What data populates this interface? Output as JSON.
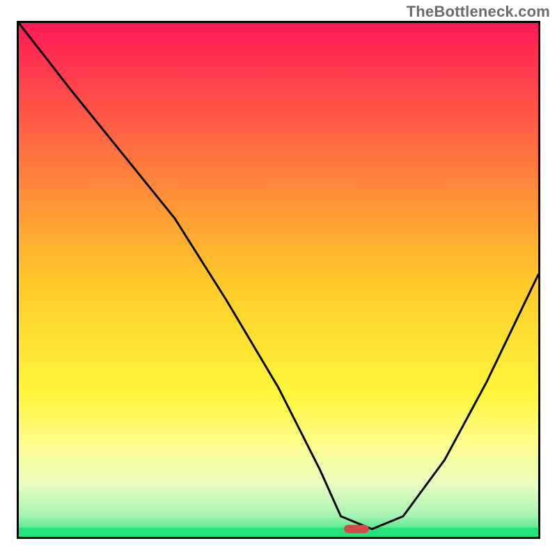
{
  "watermark": "TheBottleneck.com",
  "chart_data": {
    "type": "line",
    "title": "",
    "xlabel": "",
    "ylabel": "",
    "xlim": [
      0,
      100
    ],
    "ylim": [
      0,
      100
    ],
    "gradient_stops": [
      {
        "offset": 0,
        "color": "#ff1956"
      },
      {
        "offset": 50,
        "color": "#ffc92a"
      },
      {
        "offset": 72,
        "color": "#fff63a"
      },
      {
        "offset": 82,
        "color": "#fdfd8e"
      },
      {
        "offset": 90,
        "color": "#e8fcc2"
      },
      {
        "offset": 96,
        "color": "#a4f3b2"
      },
      {
        "offset": 100,
        "color": "#23e37a"
      }
    ],
    "optimum_marker": {
      "x": 65,
      "y": 1.5,
      "color": "#d24a4a"
    },
    "series": [
      {
        "name": "bottleneck-curve",
        "x": [
          0,
          10,
          22,
          30,
          40,
          50,
          58,
          62,
          68,
          74,
          82,
          90,
          100
        ],
        "y": [
          100,
          87,
          72,
          62,
          46,
          29,
          13,
          4,
          1.5,
          4,
          15,
          30,
          51
        ]
      }
    ]
  }
}
